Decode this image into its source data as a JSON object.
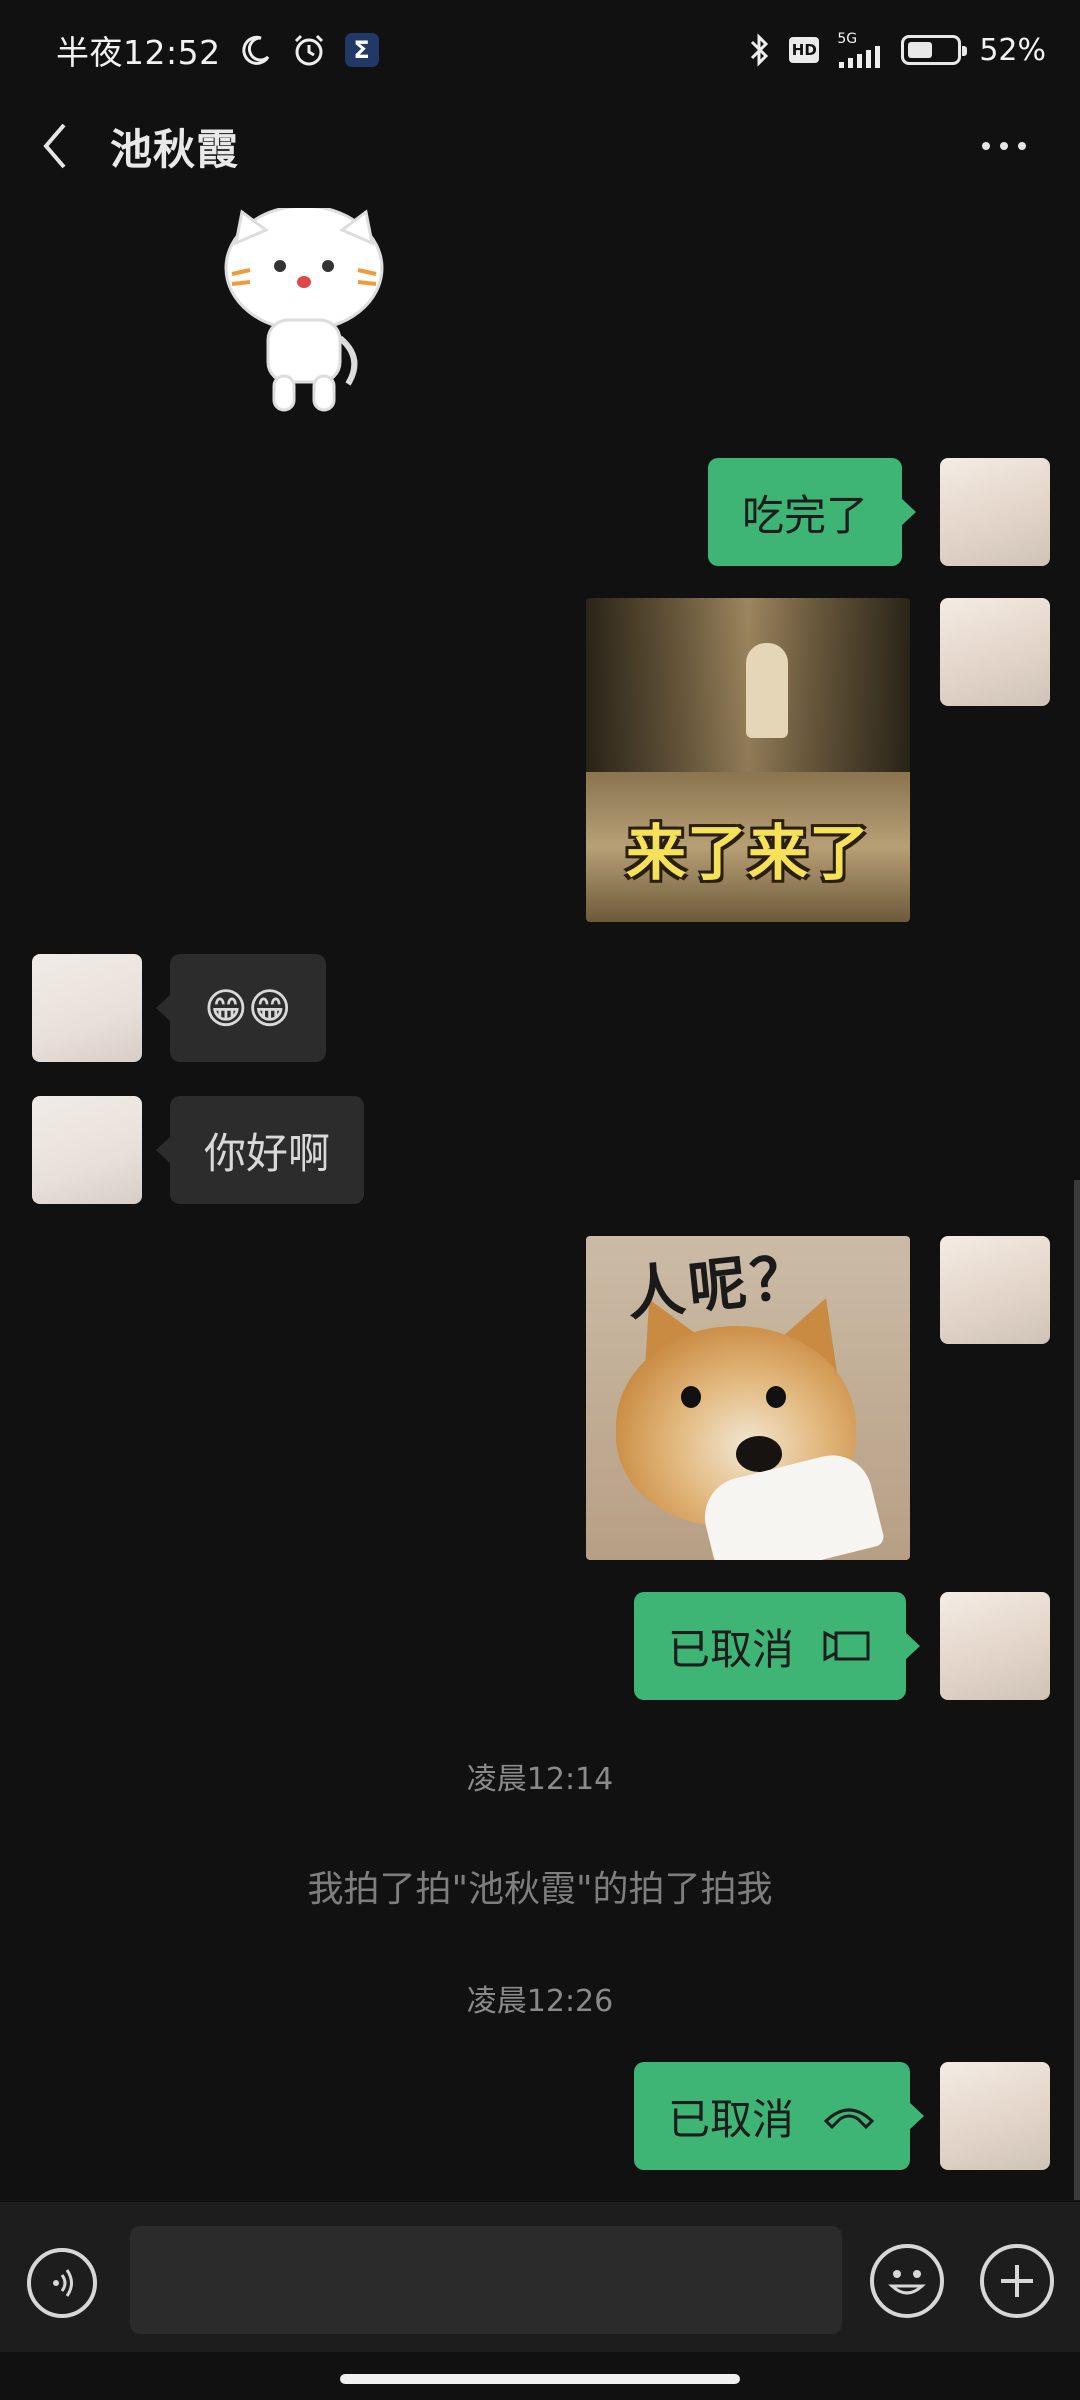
{
  "status_bar": {
    "time": "半夜12:52",
    "network": "5G",
    "battery_percent": "52%",
    "battery_level": 0.52,
    "icons": [
      "moon-icon",
      "alarm-icon",
      "sigma-app-icon",
      "bluetooth-icon",
      "hd-icon",
      "signal-icon",
      "battery-icon"
    ]
  },
  "header": {
    "contact_name": "池秋霞",
    "back_icon": "chevron-left-icon",
    "more_icon": "more-dots-icon"
  },
  "messages": {
    "m1": {
      "sender": "other",
      "type": "sticker",
      "sticker": "white-cat-sticker"
    },
    "m2": {
      "sender": "self",
      "type": "text",
      "text": "吃完了"
    },
    "m3": {
      "sender": "self",
      "type": "sticker",
      "caption": "来了来了"
    },
    "m4": {
      "sender": "other",
      "type": "emoji",
      "text": "😁😁"
    },
    "m5": {
      "sender": "other",
      "type": "text",
      "text": "你好啊"
    },
    "m6": {
      "sender": "self",
      "type": "sticker",
      "caption": "人呢？"
    },
    "m7": {
      "sender": "self",
      "type": "call",
      "text": "已取消",
      "call_icon": "video-call-icon"
    },
    "t1": {
      "type": "timestamp",
      "text": "凌晨12:14"
    },
    "s1": {
      "type": "system",
      "text": "我拍了拍\"池秋霞\"的拍了拍我"
    },
    "t2": {
      "type": "timestamp",
      "text": "凌晨12:26"
    },
    "m8": {
      "sender": "self",
      "type": "call",
      "text": "已取消",
      "call_icon": "voice-call-icon"
    }
  },
  "input_bar": {
    "value": "",
    "voice_icon": "voice-input-icon",
    "emoji_icon": "emoji-icon",
    "plus_icon": "plus-icon"
  },
  "colors": {
    "background": "#111111",
    "outgoing_bubble": "#3eb575",
    "incoming_bubble": "#2c2c2c",
    "input_bar": "#1d1d1d"
  }
}
